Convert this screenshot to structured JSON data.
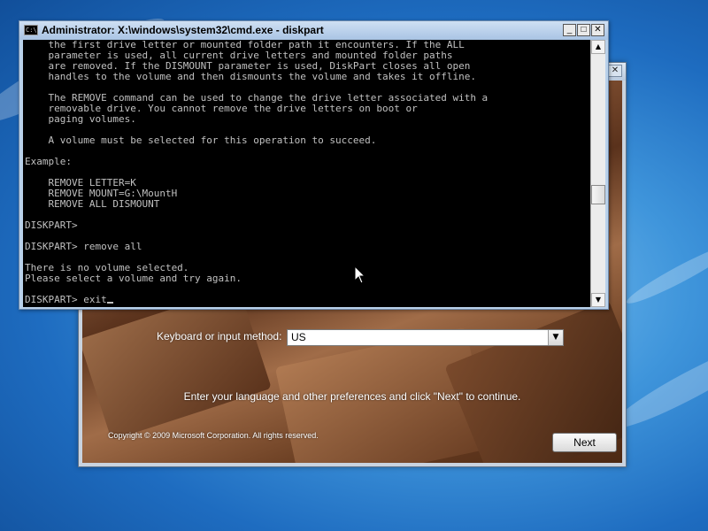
{
  "setup_window": {
    "close_glyph": "✕",
    "keyboard_label": "Keyboard or input method:",
    "keyboard_value": "US",
    "instructions": "Enter your language and other preferences and click \"Next\" to continue.",
    "copyright": "Copyright © 2009 Microsoft Corporation. All rights reserved.",
    "next_label": "Next"
  },
  "cmd_window": {
    "title": "Administrator: X:\\windows\\system32\\cmd.exe - diskpart",
    "icon_text": "C:\\",
    "minimize_glyph": "_",
    "maximize_glyph": "□",
    "close_glyph": "✕",
    "console_lines": "    the first drive letter or mounted folder path it encounters. If the ALL\n    parameter is used, all current drive letters and mounted folder paths\n    are removed. If the DISMOUNT parameter is used, DiskPart closes all open\n    handles to the volume and then dismounts the volume and takes it offline.\n\n    The REMOVE command can be used to change the drive letter associated with a\n    removable drive. You cannot remove the drive letters on boot or\n    paging volumes.\n\n    A volume must be selected for this operation to succeed.\n\nExample:\n\n    REMOVE LETTER=K\n    REMOVE MOUNT=G:\\MountH\n    REMOVE ALL DISMOUNT\n\nDISKPART>\n\nDISKPART> remove all\n\nThere is no volume selected.\nPlease select a volume and try again.\n\nDISKPART> exit",
    "scroll_up_glyph": "▲",
    "scroll_down_glyph": "▼"
  },
  "icons": {
    "mouse_pointer": "arrow-cursor"
  }
}
